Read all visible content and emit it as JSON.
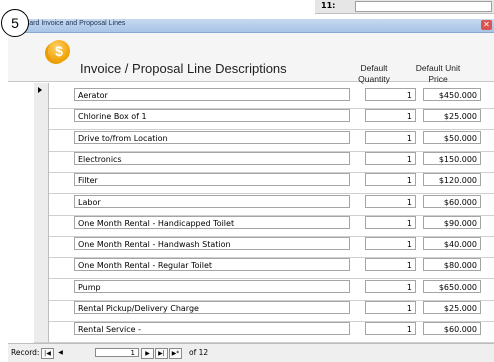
{
  "step_marker": "5",
  "background_sheet": {
    "row_number": "11:"
  },
  "window": {
    "title": "Standard Invoice and Proposal Lines",
    "close_glyph": "✕"
  },
  "header": {
    "icon": "dollar-coin-icon",
    "title": "Invoice / Proposal Line Descriptions",
    "col_quantity": "Default Quantity",
    "col_price": "Default Unit Price"
  },
  "rows": [
    {
      "description": "Aerator",
      "quantity": "1",
      "price": "$450.000"
    },
    {
      "description": "Chlorine Box of 1",
      "quantity": "1",
      "price": "$25.000"
    },
    {
      "description": "Drive to/from Location",
      "quantity": "1",
      "price": "$50.000"
    },
    {
      "description": "Electronics",
      "quantity": "1",
      "price": "$150.000"
    },
    {
      "description": "Filter",
      "quantity": "1",
      "price": "$120.000"
    },
    {
      "description": "Labor",
      "quantity": "1",
      "price": "$60.000"
    },
    {
      "description": "One Month Rental - Handicapped Toilet",
      "quantity": "1",
      "price": "$90.000"
    },
    {
      "description": "One Month Rental - Handwash Station",
      "quantity": "1",
      "price": "$40.000"
    },
    {
      "description": "One Month Rental - Regular Toilet",
      "quantity": "1",
      "price": "$80.000"
    },
    {
      "description": "Pump",
      "quantity": "1",
      "price": "$650.000"
    },
    {
      "description": "Rental Pickup/Delivery Charge",
      "quantity": "1",
      "price": "$25.000"
    },
    {
      "description": "Rental Service -",
      "quantity": "1",
      "price": "$60.000"
    }
  ],
  "nav": {
    "label": "Record:",
    "first": "|◀",
    "prev": "◀",
    "current": "1",
    "next": "▶",
    "last": "▶|",
    "new": "▶*",
    "of_text": "of 12"
  }
}
